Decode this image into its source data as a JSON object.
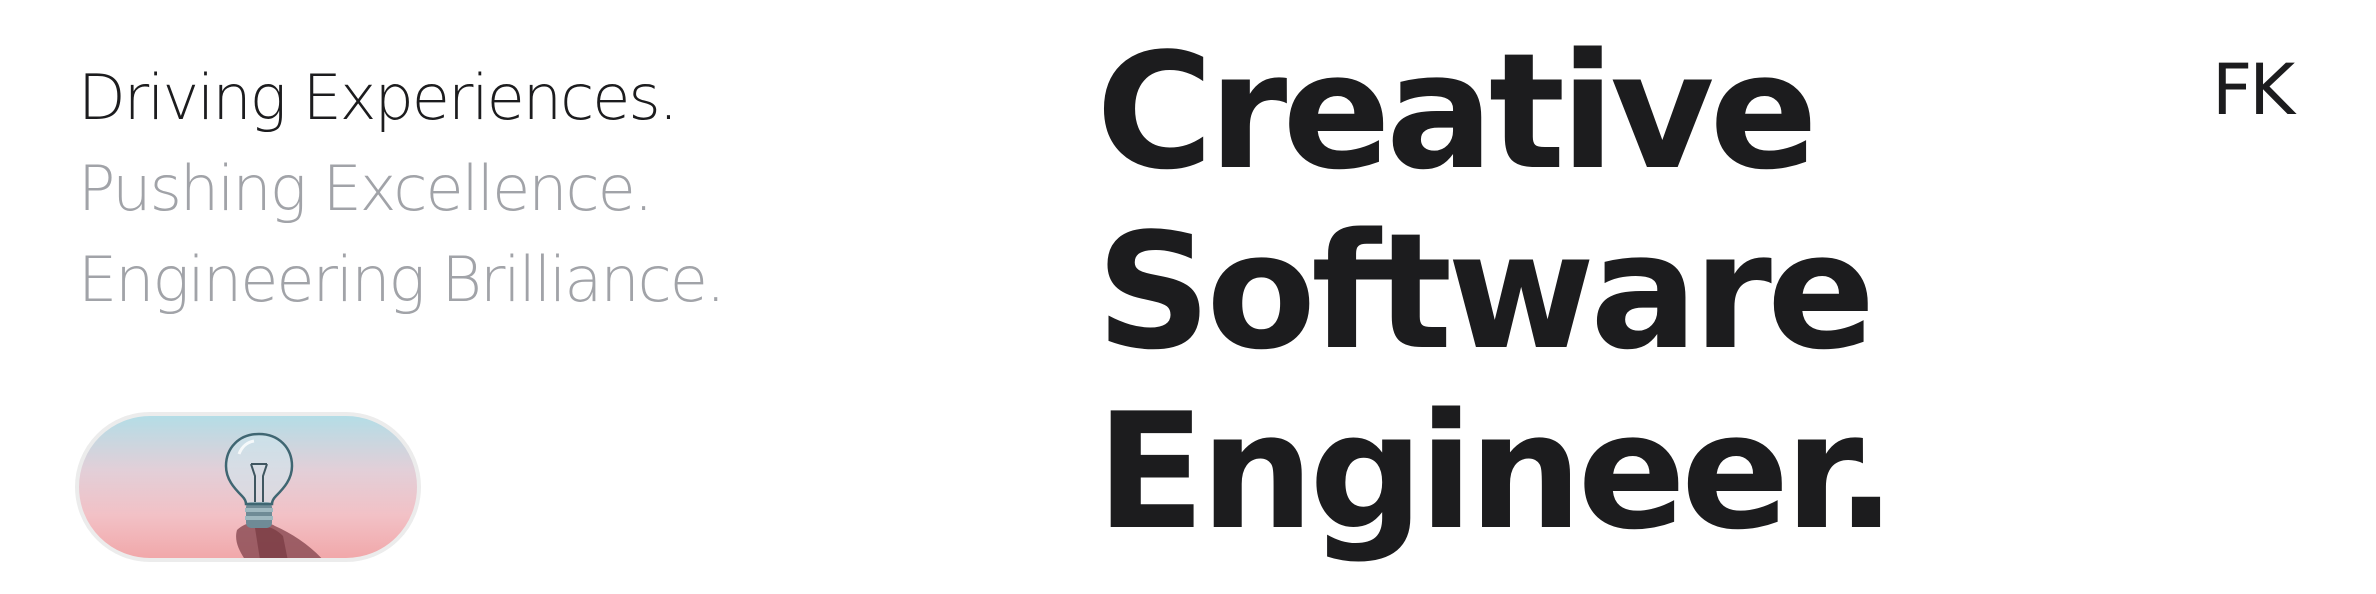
{
  "hero": {
    "taglines": [
      "Driving Experiences.",
      "Pushing Excellence.",
      "Engineering Brilliance."
    ],
    "headline_lines": [
      "Creative",
      "Software",
      "Engineer."
    ],
    "image_icon": "lightbulb-in-hand-photo"
  },
  "header": {
    "monogram": "FK"
  },
  "colors": {
    "text_primary": "#1c1c1e",
    "text_muted": "#a1a3a8",
    "background": "#ffffff"
  }
}
